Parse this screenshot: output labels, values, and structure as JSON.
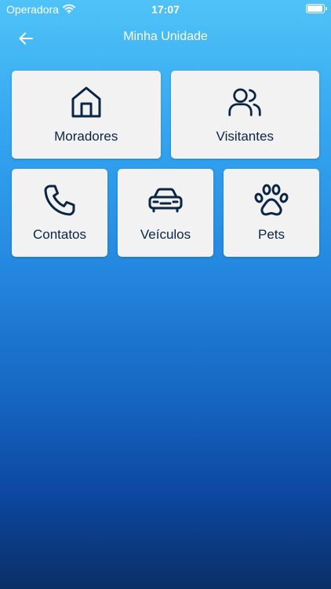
{
  "status_bar": {
    "carrier": "Operadora",
    "time": "17:07"
  },
  "nav": {
    "title": "Minha Unidade",
    "back_icon": "arrow-left-icon"
  },
  "tiles": [
    {
      "label": "Moradores",
      "icon": "house-icon"
    },
    {
      "label": "Visitantes",
      "icon": "users-icon"
    },
    {
      "label": "Contatos",
      "icon": "phone-icon"
    },
    {
      "label": "Veículos",
      "icon": "car-icon"
    },
    {
      "label": "Pets",
      "icon": "paw-icon"
    }
  ],
  "colors": {
    "gradient_top": "#4fc3f7",
    "gradient_bottom": "#0a2f66",
    "tile_background": "#f2f2f2",
    "tile_text": "#0b2545"
  }
}
